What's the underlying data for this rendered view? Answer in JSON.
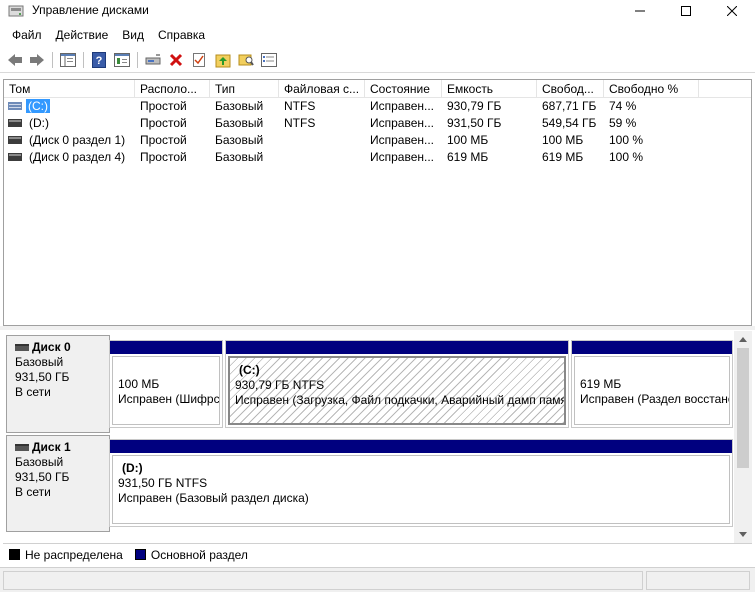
{
  "window": {
    "title": "Управление дисками",
    "min_glyph": "—",
    "max_glyph": "☐",
    "close_glyph": "✕"
  },
  "menu": [
    "Файл",
    "Действие",
    "Вид",
    "Справка"
  ],
  "toolbar": {
    "icons": [
      "back-arrow-icon",
      "forward-arrow-icon",
      "console-tree-icon",
      "help-icon",
      "properties-icon",
      "connect-drive-icon",
      "delete-icon",
      "check-icon",
      "folder-up-icon",
      "search-folder-icon",
      "list-icon"
    ]
  },
  "volume_list": {
    "columns": [
      "Том",
      "Располо...",
      "Тип",
      "Файловая с...",
      "Состояние",
      "Емкость",
      "Свобод...",
      "Свободно %"
    ],
    "rows": [
      {
        "name": "(C:)",
        "layout": "Простой",
        "type": "Базовый",
        "fs": "NTFS",
        "status": "Исправен...",
        "capacity": "930,79 ГБ",
        "free": "687,71 ГБ",
        "free_pct": "74 %",
        "selected": true
      },
      {
        "name": "(D:)",
        "layout": "Простой",
        "type": "Базовый",
        "fs": "NTFS",
        "status": "Исправен...",
        "capacity": "931,50 ГБ",
        "free": "549,54 ГБ",
        "free_pct": "59 %",
        "selected": false
      },
      {
        "name": "(Диск 0 раздел 1)",
        "layout": "Простой",
        "type": "Базовый",
        "fs": "",
        "status": "Исправен...",
        "capacity": "100 МБ",
        "free": "100 МБ",
        "free_pct": "100 %",
        "selected": false
      },
      {
        "name": "(Диск 0 раздел 4)",
        "layout": "Простой",
        "type": "Базовый",
        "fs": "",
        "status": "Исправен...",
        "capacity": "619 МБ",
        "free": "619 МБ",
        "free_pct": "100 %",
        "selected": false
      }
    ]
  },
  "disks": [
    {
      "name": "Диск 0",
      "type": "Базовый",
      "size": "931,50 ГБ",
      "state": "В сети",
      "partitions": [
        {
          "title": "",
          "size": "100 МБ",
          "status": "Исправен (Шифрс"
        },
        {
          "title": "(C:)",
          "size": "930,79 ГБ NTFS",
          "status": "Исправен (Загрузка, Файл подкачки, Аварийный дамп памя"
        },
        {
          "title": "",
          "size": "619 МБ",
          "status": "Исправен (Раздел восстано"
        }
      ]
    },
    {
      "name": "Диск 1",
      "type": "Базовый",
      "size": "931,50 ГБ",
      "state": "В сети",
      "partitions": [
        {
          "title": "(D:)",
          "size": "931,50 ГБ NTFS",
          "status": "Исправен (Базовый раздел диска)"
        }
      ]
    }
  ],
  "legend": [
    {
      "label": "Не распределена",
      "color": "#000000"
    },
    {
      "label": "Основной раздел",
      "color": "#00007f"
    }
  ],
  "colors": {
    "partition_bar": "#00007f",
    "selection": "#3399ff"
  }
}
